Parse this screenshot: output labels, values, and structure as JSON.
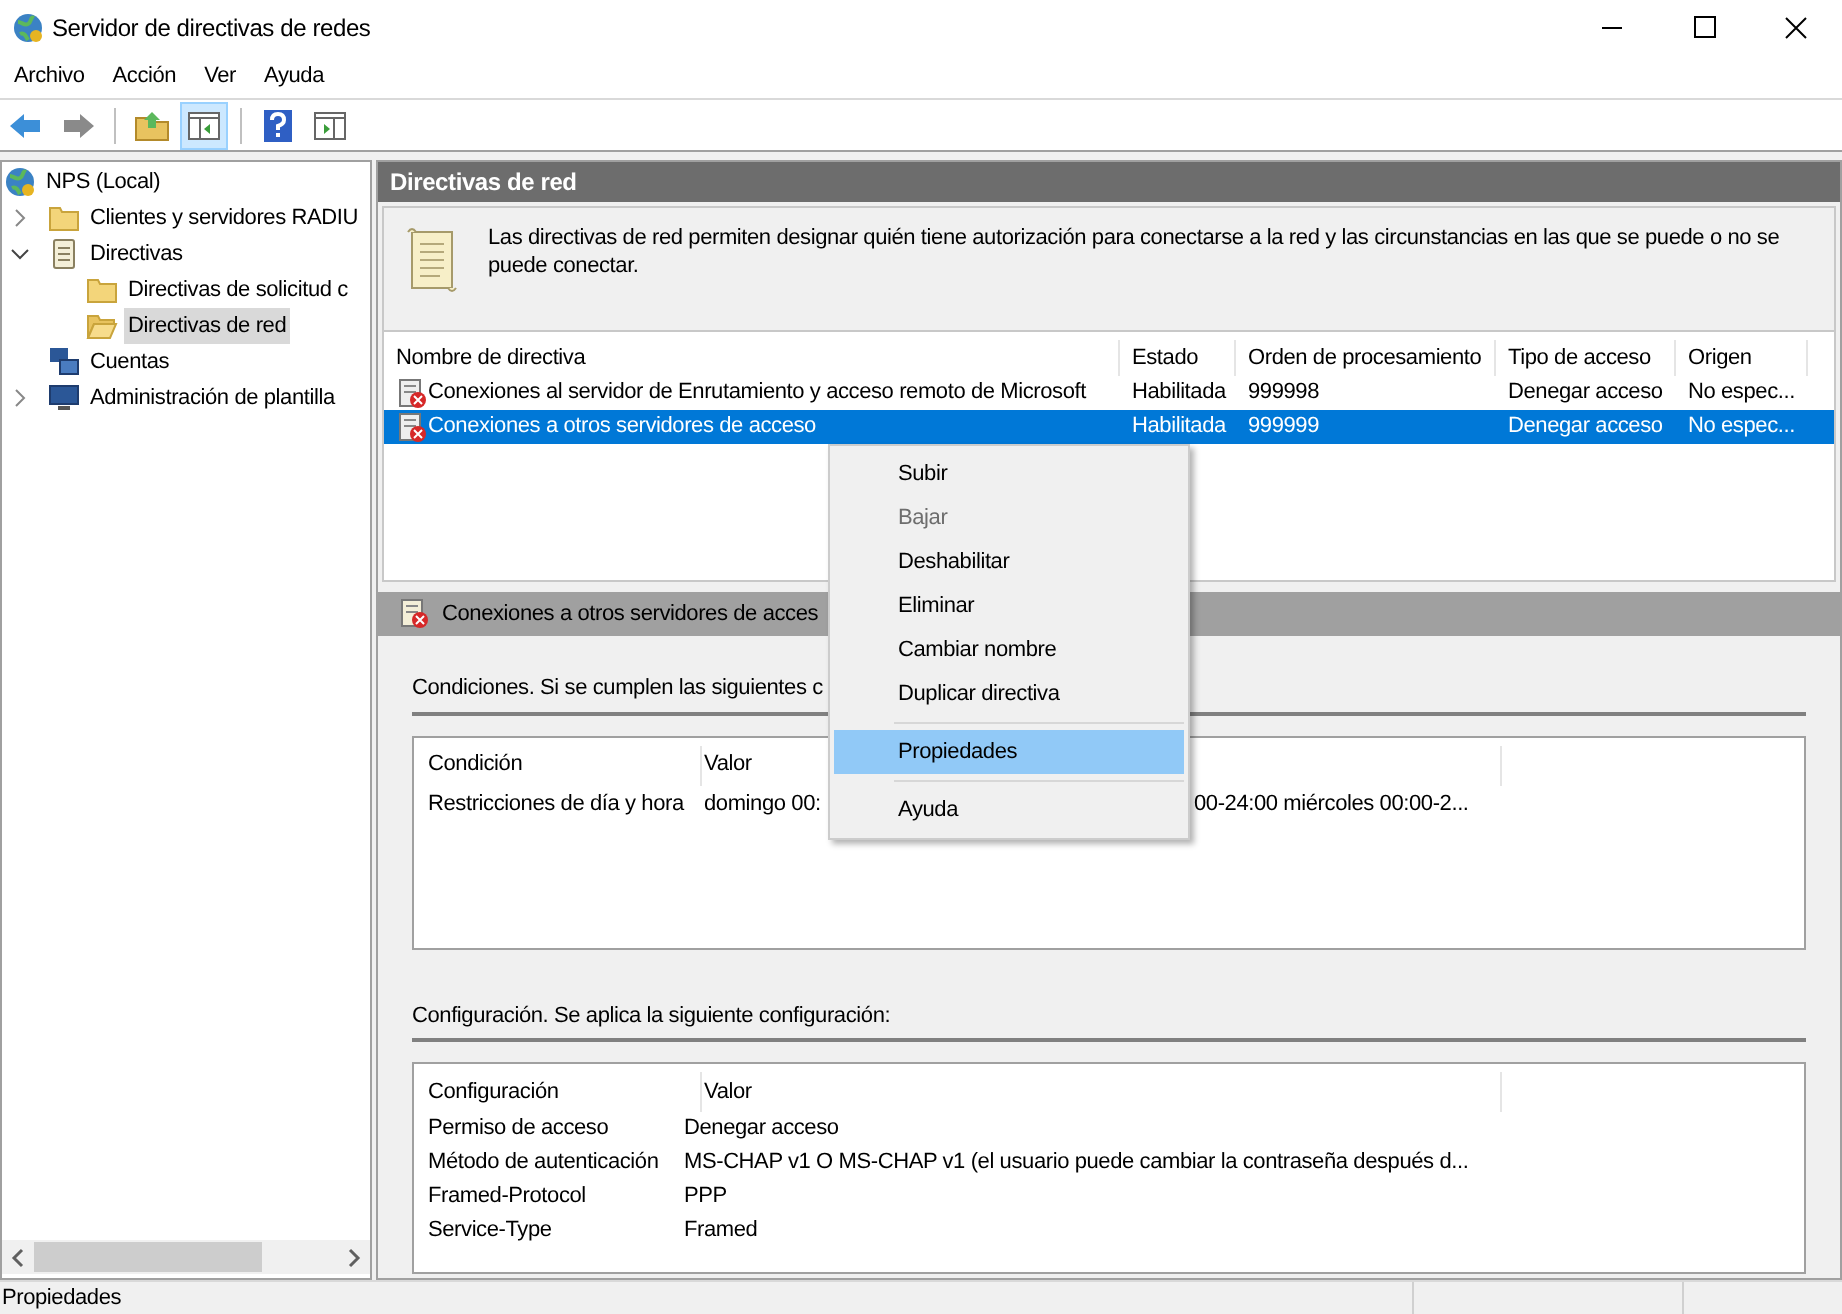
{
  "window": {
    "title": "Servidor de directivas de redes"
  },
  "menu": [
    "Archivo",
    "Acción",
    "Ver",
    "Ayuda"
  ],
  "toolbar": [
    {
      "kind": "back",
      "pressed": false
    },
    {
      "kind": "forward",
      "pressed": false
    },
    {
      "kind": "sep"
    },
    {
      "kind": "up",
      "pressed": false
    },
    {
      "kind": "tree",
      "pressed": true
    },
    {
      "kind": "sep"
    },
    {
      "kind": "help",
      "pressed": false
    },
    {
      "kind": "action",
      "pressed": false
    }
  ],
  "tree": [
    {
      "label": "NPS (Local)",
      "children": [
        {
          "label": "Clientes y servidores RADIU",
          "expanded": false,
          "selected": false
        },
        {
          "label": "Directivas",
          "expanded": true,
          "selected": false,
          "children": [
            {
              "label": "Directivas de solicitud c",
              "selected": false
            },
            {
              "label": "Directivas de red",
              "selected": true
            }
          ]
        },
        {
          "label": "Cuentas",
          "selected": false
        },
        {
          "label": "Administración de plantilla",
          "expanded": false,
          "selected": false
        }
      ]
    }
  ],
  "panel": {
    "title": "Directivas de red",
    "description": "Las directivas de red permiten designar quién tiene autorización para conectarse a la red y las circunstancias en las que se puede o no se puede conectar."
  },
  "policies": {
    "columns": [
      "Nombre de directiva",
      "Estado",
      "Orden de procesamiento",
      "Tipo de acceso",
      "Origen"
    ],
    "rows": [
      {
        "cells": [
          "Conexiones al servidor de Enrutamiento y acceso remoto de Microsoft",
          "Habilitada",
          "999998",
          "Denegar acceso",
          "No espec..."
        ],
        "selected": false
      },
      {
        "cells": [
          "Conexiones a otros servidores de acceso",
          "Habilitada",
          "999999",
          "Denegar acceso",
          "No espec..."
        ],
        "selected": true
      }
    ]
  },
  "details": {
    "title": "Conexiones a otros servidores de acces",
    "conditions": {
      "label": "Condiciones. Si se cumplen las siguientes c",
      "columns": [
        "Condición",
        "Valor"
      ],
      "rows": [
        {
          "name": "Restricciones de día y hora",
          "value_parts": [
            "domingo 00:",
            "00-24:00 miércoles 00:00-2..."
          ]
        }
      ]
    },
    "settings": {
      "label": "Configuración. Se aplica la siguiente configuración:",
      "columns": [
        "Configuración",
        "Valor"
      ],
      "rows": [
        [
          "Permiso de acceso",
          "Denegar acceso"
        ],
        [
          "Método de autenticación",
          "MS-CHAP v1 O MS-CHAP v1 (el usuario puede cambiar la contraseña después d..."
        ],
        [
          "Framed-Protocol",
          "PPP"
        ],
        [
          "Service-Type",
          "Framed"
        ]
      ]
    }
  },
  "context_menu": [
    {
      "label": "Subir",
      "disabled": false,
      "selected": false
    },
    {
      "label": "Bajar",
      "disabled": true,
      "selected": false
    },
    {
      "label": "Deshabilitar",
      "disabled": false,
      "selected": false
    },
    {
      "label": "Eliminar",
      "disabled": false,
      "selected": false
    },
    {
      "label": "Cambiar nombre",
      "disabled": false,
      "selected": false
    },
    {
      "label": "Duplicar directiva",
      "disabled": false,
      "selected": false
    },
    {
      "kind": "separator"
    },
    {
      "label": "Propiedades",
      "disabled": false,
      "selected": true
    },
    {
      "kind": "separator"
    },
    {
      "label": "Ayuda",
      "disabled": false,
      "selected": false
    }
  ],
  "status_bar": "Propiedades"
}
